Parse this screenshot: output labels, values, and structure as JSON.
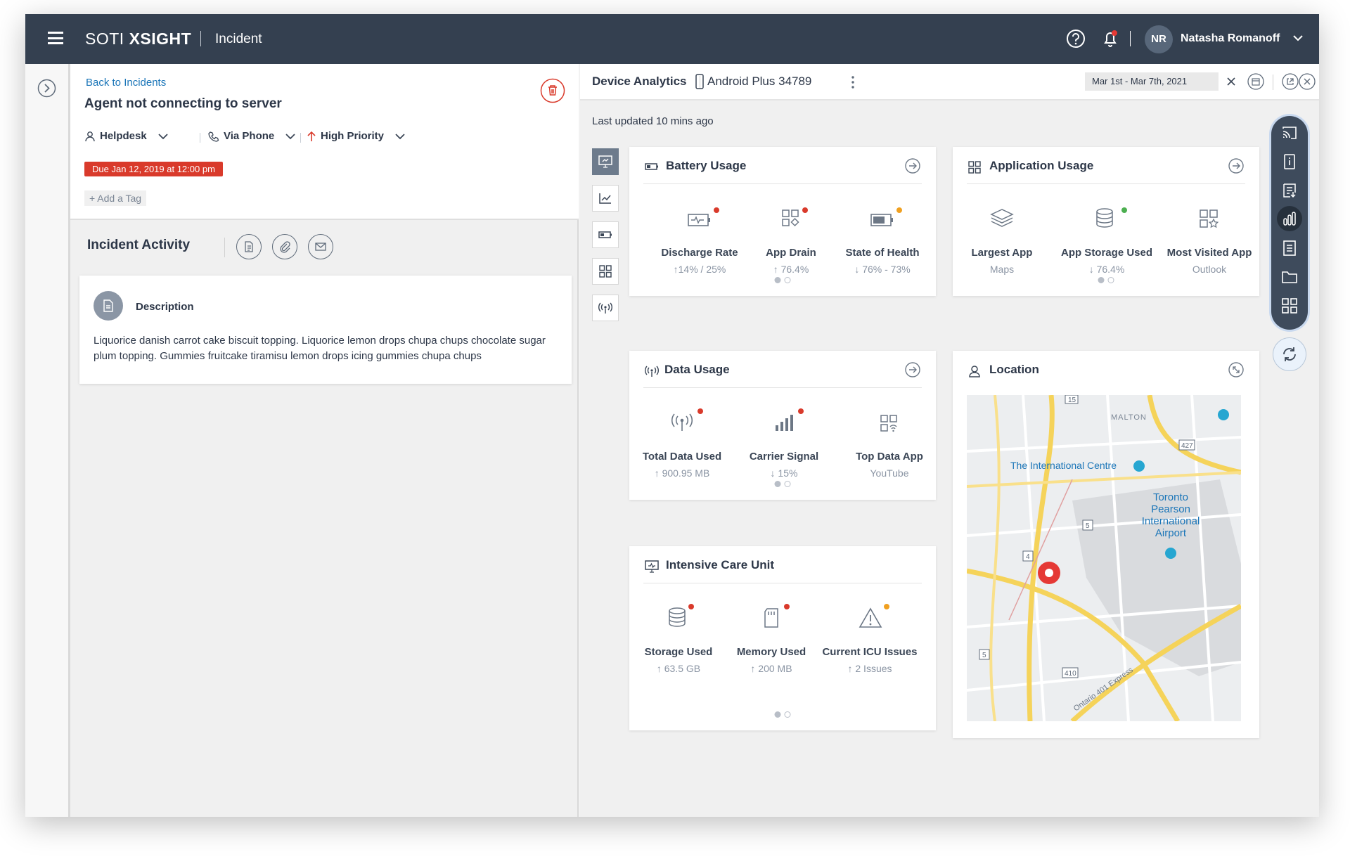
{
  "app": {
    "brand_light": "SOTI ",
    "brand_bold": "XSIGHT",
    "page": "Incident"
  },
  "user": {
    "initials": "NR",
    "name": "Natasha Romanoff"
  },
  "incident": {
    "back_link": "Back to Incidents",
    "title": "Agent not connecting to server",
    "assignee": "Helpdesk",
    "channel": "Via Phone",
    "priority": "High Priority",
    "due": "Due Jan 12, 2019 at 12:00 pm",
    "add_tag": "+ Add a Tag",
    "activity_title": "Incident Activity",
    "description_label": "Description",
    "description_text": "Liquorice danish carrot cake biscuit topping. Liquorice lemon drops chupa chups chocolate sugar plum topping. Gummies fruitcake tiramisu lemon drops icing gummies chupa chups"
  },
  "analytics": {
    "title": "Device Analytics",
    "device": "Android Plus 34789",
    "date_range": "Mar 1st - Mar 7th, 2021",
    "updated": "Last updated 10 mins ago"
  },
  "battery": {
    "title": "Battery Usage",
    "metrics": [
      {
        "label": "Discharge Rate",
        "value": "↑14% / 25%",
        "dot": "#d93a2b"
      },
      {
        "label": "App Drain",
        "value": "↑ 76.4%",
        "dot": "#d93a2b"
      },
      {
        "label": "State of Health",
        "value": "↓ 76% - 73%",
        "dot": "#f0a020"
      }
    ]
  },
  "application": {
    "title": "Application Usage",
    "metrics": [
      {
        "label": "Largest App",
        "value": "Maps"
      },
      {
        "label": "App Storage Used",
        "value": "↓ 76.4%",
        "dot": "#4caf50"
      },
      {
        "label": "Most Visited App",
        "value": "Outlook"
      }
    ]
  },
  "data_usage": {
    "title": "Data Usage",
    "metrics": [
      {
        "label": "Total Data Used",
        "value": "↑ 900.95 MB",
        "dot": "#d93a2b"
      },
      {
        "label": "Carrier Signal",
        "value": "↓ 15%",
        "dot": "#d93a2b"
      },
      {
        "label": "Top Data App",
        "value": "YouTube"
      }
    ]
  },
  "icu": {
    "title": "Intensive Care Unit",
    "metrics": [
      {
        "label": "Storage Used",
        "value": "↑ 63.5 GB",
        "dot": "#d93a2b"
      },
      {
        "label": "Memory Used",
        "value": "↑ 200 MB",
        "dot": "#d93a2b"
      },
      {
        "label": "Current ICU Issues",
        "value": "↑ 2 Issues",
        "dot": "#f0a020"
      }
    ]
  },
  "location": {
    "title": "Location",
    "labels": {
      "malton": "MALTON",
      "intl_centre": "The International Centre",
      "airport": "Toronto Pearson International Airport",
      "expressway": "Ontario 401 Express",
      "r427": "427",
      "r5": "5",
      "r4": "4",
      "r410": "410",
      "r15": "15",
      "r5b": "5"
    }
  }
}
